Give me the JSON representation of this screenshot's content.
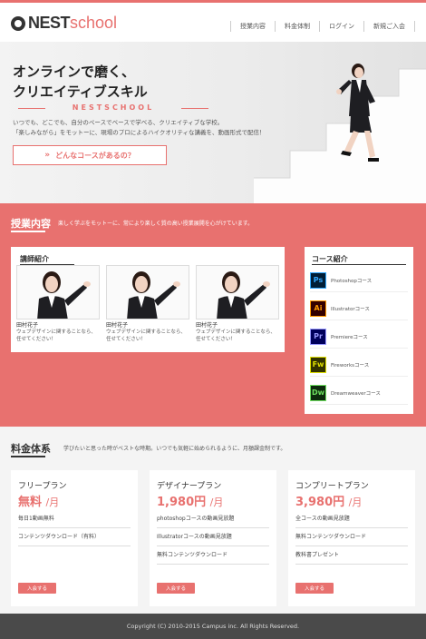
{
  "header": {
    "logo_nest": "NEST",
    "logo_school": "school",
    "nav": [
      "授業内容",
      "料金体制",
      "ログイン",
      "新規ご入会"
    ]
  },
  "hero": {
    "title_line1": "オンラインで磨く、",
    "title_line2": "クリエイティブスキル",
    "subtitle": "NESTSCHOOL",
    "text_line1": "いつでも、どこでも、自分のペースでベースで学べる、クリエイティブな学校。",
    "text_line2": "「楽しみながら」をモットーに、現場のプロによるハイクオリティな講義を、動画形式で配信！",
    "cta_label": "どんなコースがあるの？",
    "cta_icon": "double-chevron-right-icon"
  },
  "lessons": {
    "title": "授業内容",
    "description": "楽しく学ぶをモットーに、常により楽しく質の高い授業展開を心がけています。",
    "teachers": {
      "title": "講師紹介",
      "items": [
        {
          "name": "田村花子",
          "desc_line1": "ウェブデザインに関することなら、",
          "desc_line2": "任せてください！"
        },
        {
          "name": "田村花子",
          "desc_line1": "ウェブデザインに関することなら、",
          "desc_line2": "任せてください！"
        },
        {
          "name": "田村花子",
          "desc_line1": "ウェブデザインに関することなら、",
          "desc_line2": "任せてください！"
        }
      ]
    },
    "courses": {
      "title": "コース紹介",
      "items": [
        {
          "abbr": "Ps",
          "label": "Photoshopコース",
          "color": "#31a8ff",
          "bg": "#001e36"
        },
        {
          "abbr": "Ai",
          "label": "Illustratorコース",
          "color": "#ff9a00",
          "bg": "#330000"
        },
        {
          "abbr": "Pr",
          "label": "Premiereコース",
          "color": "#9999ff",
          "bg": "#00005b"
        },
        {
          "abbr": "Fw",
          "label": "Fireworksコース",
          "color": "#e0e000",
          "bg": "#333300"
        },
        {
          "abbr": "Dw",
          "label": "Dreamweaverコース",
          "color": "#6ee060",
          "bg": "#0d2b0d"
        }
      ]
    }
  },
  "pricing": {
    "title": "料金体系",
    "description": "学びたいと思った時がベストな時期。いつでも気軽に始められるように、月額課金制です。",
    "plans": [
      {
        "name": "フリープラン",
        "price": "無料",
        "unit": "/月",
        "features": [
          "毎日1動画無料",
          "コンテンツダウンロード（有料）"
        ],
        "button": "入会する"
      },
      {
        "name": "デザイナープラン",
        "price": "1,980円",
        "unit": "/月",
        "features": [
          "photoshopコースの動画見放題",
          "Illustratorコースの動画見放題",
          "無料コンテンツダウンロード"
        ],
        "button": "入会する"
      },
      {
        "name": "コンプリートプラン",
        "price": "3,980円",
        "unit": "/月",
        "features": [
          "全コースの動画見放題",
          "無料コンテンツダウンロード",
          "教科書プレゼント"
        ],
        "button": "入会する"
      }
    ]
  },
  "footer": {
    "copyright": "Copyright (C) 2010-2015 Campus inc. All Rights Reserved."
  },
  "colors": {
    "accent": "#e8716f",
    "footer": "#4a4a4a"
  }
}
